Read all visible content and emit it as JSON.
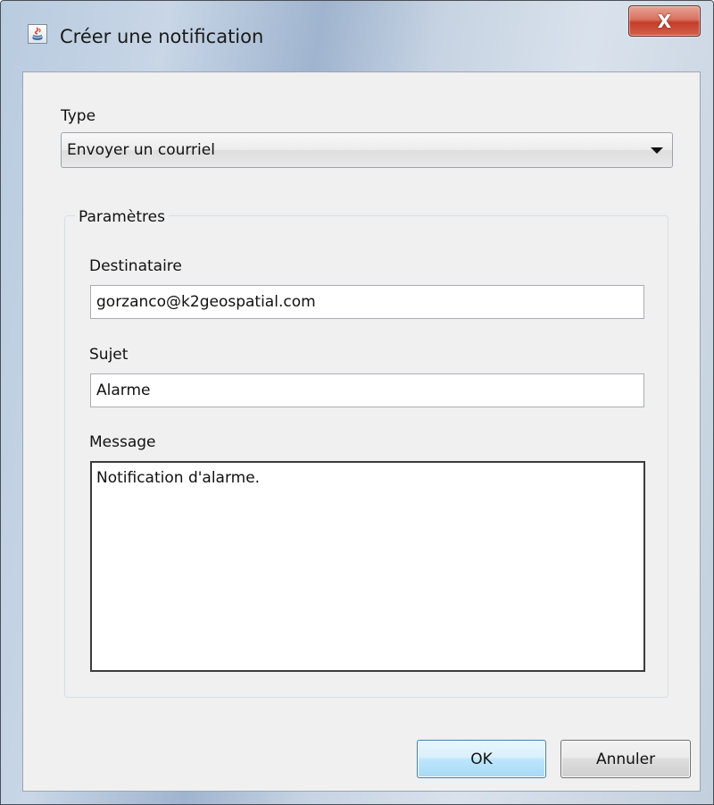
{
  "window": {
    "title": "Créer une notification",
    "close_glyph": "X",
    "icon": "java-cup-icon"
  },
  "type_section": {
    "label": "Type",
    "selected": "Envoyer un courriel"
  },
  "parameters": {
    "legend": "Paramètres",
    "recipient_label": "Destinataire",
    "recipient_value": "gorzanco@k2geospatial.com",
    "subject_label": "Sujet",
    "subject_value": "Alarme",
    "message_label": "Message",
    "message_value": "Notification d'alarme."
  },
  "buttons": {
    "ok": "OK",
    "cancel": "Annuler"
  },
  "colors": {
    "dialog_background": "#f0f0f0",
    "close_button": "#c43d2a",
    "ok_button_border": "#3c7fb1"
  }
}
